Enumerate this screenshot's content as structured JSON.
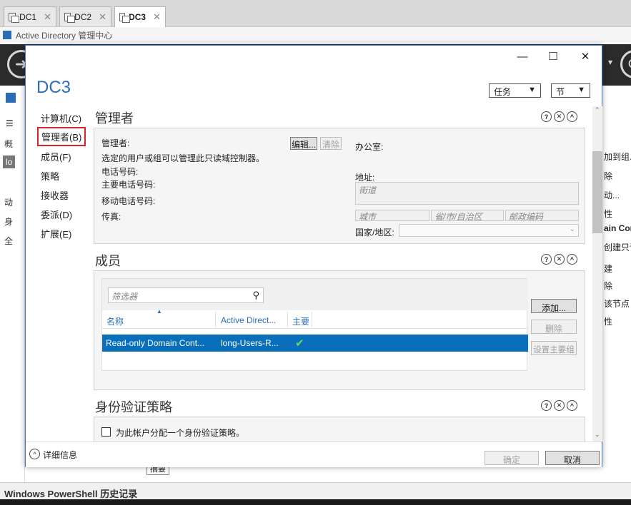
{
  "tabs": [
    {
      "label": "DC1"
    },
    {
      "label": "DC2"
    },
    {
      "label": "DC3"
    }
  ],
  "app_title": "Active Directory 管理中心",
  "background": {
    "left_nav": [
      "概",
      "lo",
      "动",
      "身",
      "全"
    ],
    "right_tasks": [
      "加到组...",
      "除",
      "动...",
      "性",
      "ain Cor",
      "创建只读",
      "建",
      "除",
      "该节点",
      "性"
    ],
    "powershell_label": "Windows PowerShell 历史记录",
    "summary_fragment": "摘要"
  },
  "dialog": {
    "title": "DC3",
    "window_controls": {
      "minimize": "—",
      "maximize": "☐",
      "close": "✕"
    },
    "tasks_dropdown": "任务",
    "sections_dropdown": "节",
    "nav": [
      "计算机(C)",
      "管理者(B)",
      "成员(F)",
      "策略",
      "接收器",
      "委派(D)",
      "扩展(E)"
    ],
    "managed_by": {
      "heading": "管理者",
      "label_manager": "管理者:",
      "edit_button": "编辑...",
      "clear_button": "清除",
      "description": "选定的用户或组可以管理此只读域控制器。",
      "phone": "电话号码:",
      "main_phone": "主要电话号码:",
      "mobile_phone": "移动电话号码:",
      "fax": "传真:",
      "office": "办公室:",
      "address": "地址:",
      "street_placeholder": "街道",
      "city_placeholder": "城市",
      "state_placeholder": "省/市/自治区",
      "zip_placeholder": "邮政编码",
      "country": "国家/地区:"
    },
    "members": {
      "heading": "成员",
      "filter_placeholder": "筛选器",
      "columns": [
        "名称",
        "Active Direct...",
        "主要"
      ],
      "rows": [
        {
          "name": "Read-only Domain Cont...",
          "path": "long-Users-R...",
          "primary": "✔"
        }
      ],
      "add_button": "添加...",
      "remove_button": "删除",
      "set_primary_button": "设置主要组"
    },
    "auth_policy": {
      "heading": "身份验证策略",
      "checkbox_label": "为此帐户分配一个身份验证策略。"
    },
    "section_controls": {
      "help": "?",
      "close": "✕",
      "collapse": "^"
    },
    "footer": {
      "details": "详细信息",
      "ok": "确定",
      "cancel": "取消"
    }
  }
}
